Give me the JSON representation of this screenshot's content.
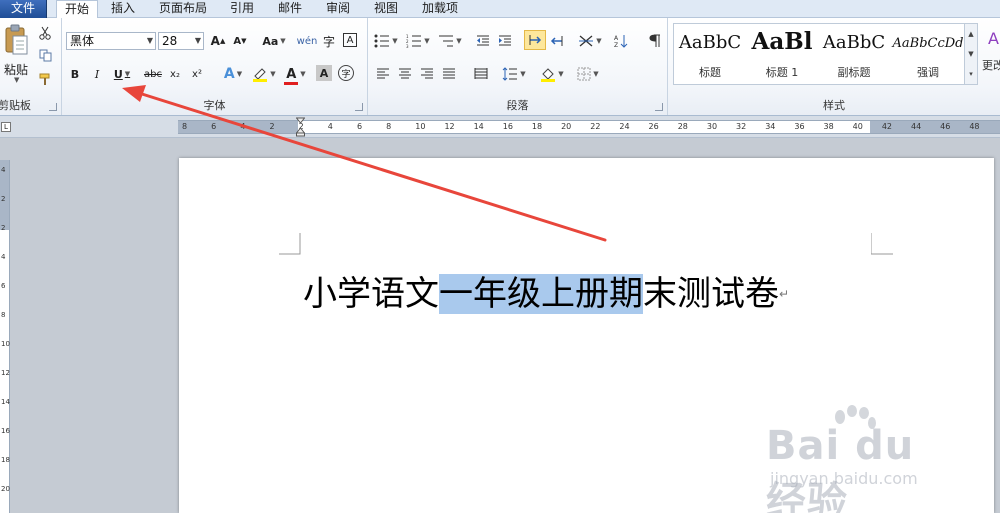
{
  "tabs": [
    {
      "label": "文件",
      "key": "file"
    },
    {
      "label": "开始",
      "key": "home"
    },
    {
      "label": "插入",
      "key": "insert"
    },
    {
      "label": "页面布局",
      "key": "layout"
    },
    {
      "label": "引用",
      "key": "references"
    },
    {
      "label": "邮件",
      "key": "mailings"
    },
    {
      "label": "审阅",
      "key": "review"
    },
    {
      "label": "视图",
      "key": "view"
    },
    {
      "label": "加载项",
      "key": "addins"
    }
  ],
  "clipboard": {
    "paste_label": "粘贴",
    "group_label": "剪贴板"
  },
  "font": {
    "name": "黑体",
    "size": "28",
    "group_label": "字体",
    "grow": "A",
    "shrink": "A",
    "change_case": "Aa",
    "bold": "B",
    "italic": "I",
    "underline": "U",
    "strikethrough": "abc",
    "subscript": "x₂",
    "superscript": "x²",
    "text_effect": "A",
    "font_color": "A",
    "char_shading": "A",
    "enclose": "字",
    "phonetic": "wén",
    "border": "A"
  },
  "paragraph": {
    "group_label": "段落"
  },
  "styles": {
    "group_label": "样式",
    "items": [
      {
        "sample": "AaBbC",
        "name": "标题"
      },
      {
        "sample": "AaBl",
        "name": "标题 1"
      },
      {
        "sample": "AaBbC",
        "name": "副标题"
      },
      {
        "sample": "AaBbCcDd",
        "name": "强调"
      }
    ],
    "change_label": "更改"
  },
  "ruler": {
    "ticks": [
      "8",
      "6",
      "4",
      "2",
      "2",
      "4",
      "6",
      "8",
      "10",
      "12",
      "14",
      "16",
      "18",
      "20",
      "22",
      "24",
      "26",
      "28",
      "30",
      "32",
      "34",
      "36",
      "38",
      "40",
      "42",
      "44",
      "46",
      "48"
    ],
    "vticks": [
      "4",
      "2",
      "2",
      "4",
      "6",
      "8",
      "10",
      "12",
      "14",
      "16",
      "18",
      "20"
    ]
  },
  "document": {
    "before": "小学语文",
    "selected": "一年级上册期",
    "after": "末测试卷"
  },
  "watermark": {
    "logo": "Bai du 经验",
    "url": "jingyan.baidu.com"
  },
  "colors": {
    "accent": "#2b579a",
    "selection": "#a9c9ed",
    "arrow": "#e8463b",
    "font_color_bar": "#e01f1f",
    "highlight_bar": "#ffee00"
  }
}
